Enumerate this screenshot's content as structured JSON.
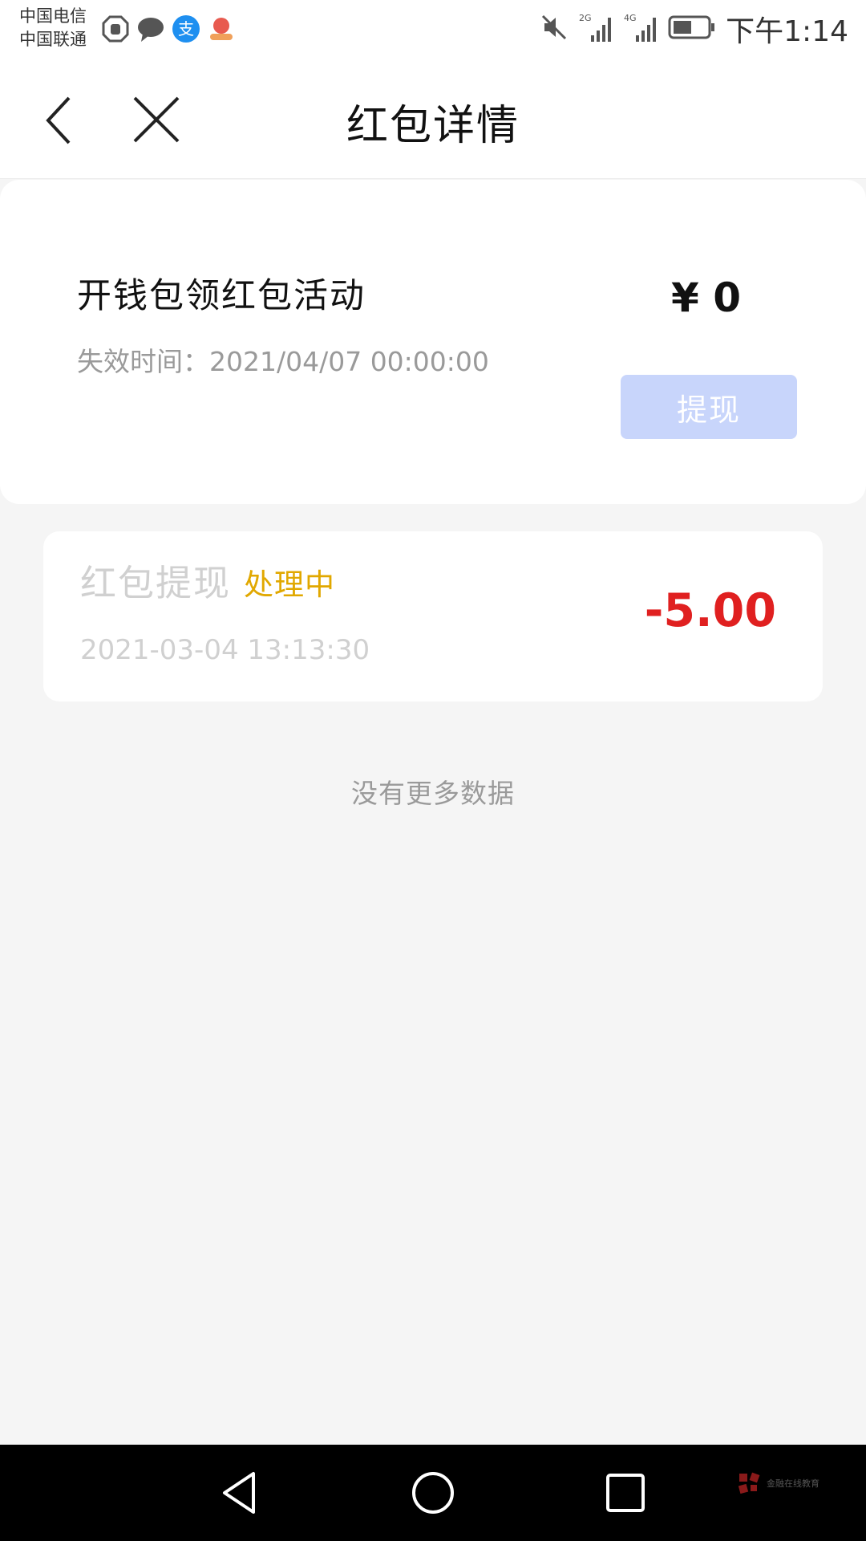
{
  "status_bar": {
    "carrier_1": "中国电信",
    "carrier_2": "中国联通",
    "notification_icons": [
      "block-icon",
      "chat-bubble-icon",
      "alipay-icon",
      "app-badge-icon"
    ],
    "network_1": "2G",
    "network_2": "4G",
    "time": "下午1:14"
  },
  "header": {
    "title": "红包详情"
  },
  "summary": {
    "activity_name": "开钱包领红包活动",
    "expire_label": "失效时间：",
    "expire_time": "2021/04/07 00:00:00",
    "balance": "¥ 0",
    "withdraw_label": "提现"
  },
  "records": [
    {
      "title": "红包提现",
      "status": "处理中",
      "time": "2021-03-04 13:13:30",
      "amount": "-5.00"
    }
  ],
  "footer": {
    "no_more_text": "没有更多数据"
  },
  "watermark": {
    "text": "金融在线教育"
  },
  "colors": {
    "accent_button": "#c8d5fb",
    "status_pending": "#e1a800",
    "amount_negative": "#e02020",
    "background": "#f5f5f5"
  }
}
